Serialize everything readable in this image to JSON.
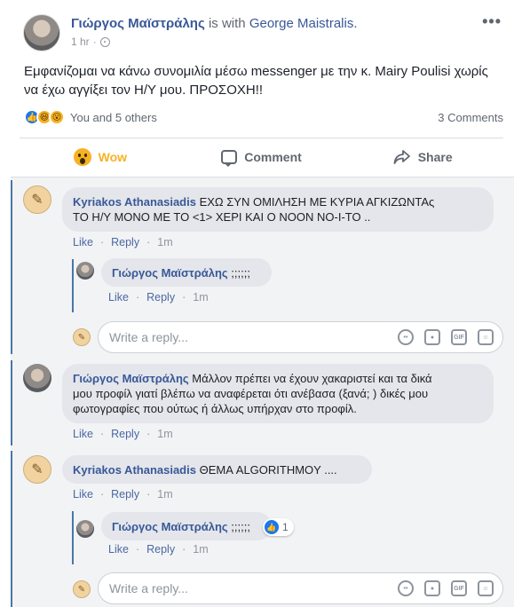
{
  "post": {
    "author": "Γιώργος Μαϊστράλης",
    "with_text": "is with",
    "with_name": "George Maistralis.",
    "time": "1 hr",
    "more": "•••",
    "text": "Εμφανίζομαι να κάνω συνομιλία μέσω messenger με την κ. Mairy Poulisi χωρίς να έχω αγγίξει τον Η/Υ μου. ΠΡΟΣΟΧΗ!!",
    "reactions_text": "You and 5 others",
    "comments_count": "3 Comments"
  },
  "actions": {
    "wow": "Wow",
    "comment": "Comment",
    "share": "Share"
  },
  "comments": [
    {
      "author": "Kyriakos Athanasiadis",
      "line1": "ΕΧΩ ΣΥΝ ΟΜΙΛΗΣΗ ΜΕ ΚΥΡΙΑ ΑΓΚΙΖΩΝΤΑς",
      "line2": "ΤΟ Η/Υ ΜΟΝΟ ΜΕ ΤΟ <1> ΧΕΡΙ ΚΑΙ Ο ΝΟΟΝ ΝΟ-Ι-ΤΟ ..",
      "like": "Like",
      "reply": "Reply",
      "time": "1m",
      "replies": [
        {
          "author": "Γιώργος Μαϊστράλης",
          "text": ";;;;;;",
          "like": "Like",
          "reply": "Reply",
          "time": "1m"
        }
      ]
    },
    {
      "author": "Γιώργος Μαϊστράλης",
      "line1": "Μάλλον πρέπει να έχουν χακαριστεί και τα δικά",
      "line2": "μου προφίλ γιατί βλέπω να αναφέρεται ότι ανέβασα (ξανά; ) δικές μου",
      "line3": "φωτογραφίες που ούτως ή άλλως υπήρχαν στο προφίλ.",
      "like": "Like",
      "reply": "Reply",
      "time": "1m"
    },
    {
      "author": "Kyriakos Athanasiadis",
      "line1": "ΘΕΜΑ ALGORITHMOY ....",
      "like": "Like",
      "reply": "Reply",
      "time": "1m",
      "replies": [
        {
          "author": "Γιώργος Μαϊστράλης",
          "text": ";;;;;;",
          "like": "Like",
          "reply": "Reply",
          "time": "1m",
          "like_count": "1"
        }
      ]
    }
  ],
  "reply_box": {
    "placeholder": "Write a reply..."
  },
  "colors": {
    "link": "#385898",
    "wow": "#f7b125",
    "like": "#1877f2",
    "panel_bg": "#f2f3f5"
  },
  "icons": [
    "globe-icon",
    "more-icon",
    "like-reaction-icon",
    "haha-reaction-icon",
    "wow-reaction-icon",
    "comment-icon",
    "share-icon",
    "emoji-icon",
    "camera-icon",
    "gif-icon",
    "sticker-icon"
  ]
}
